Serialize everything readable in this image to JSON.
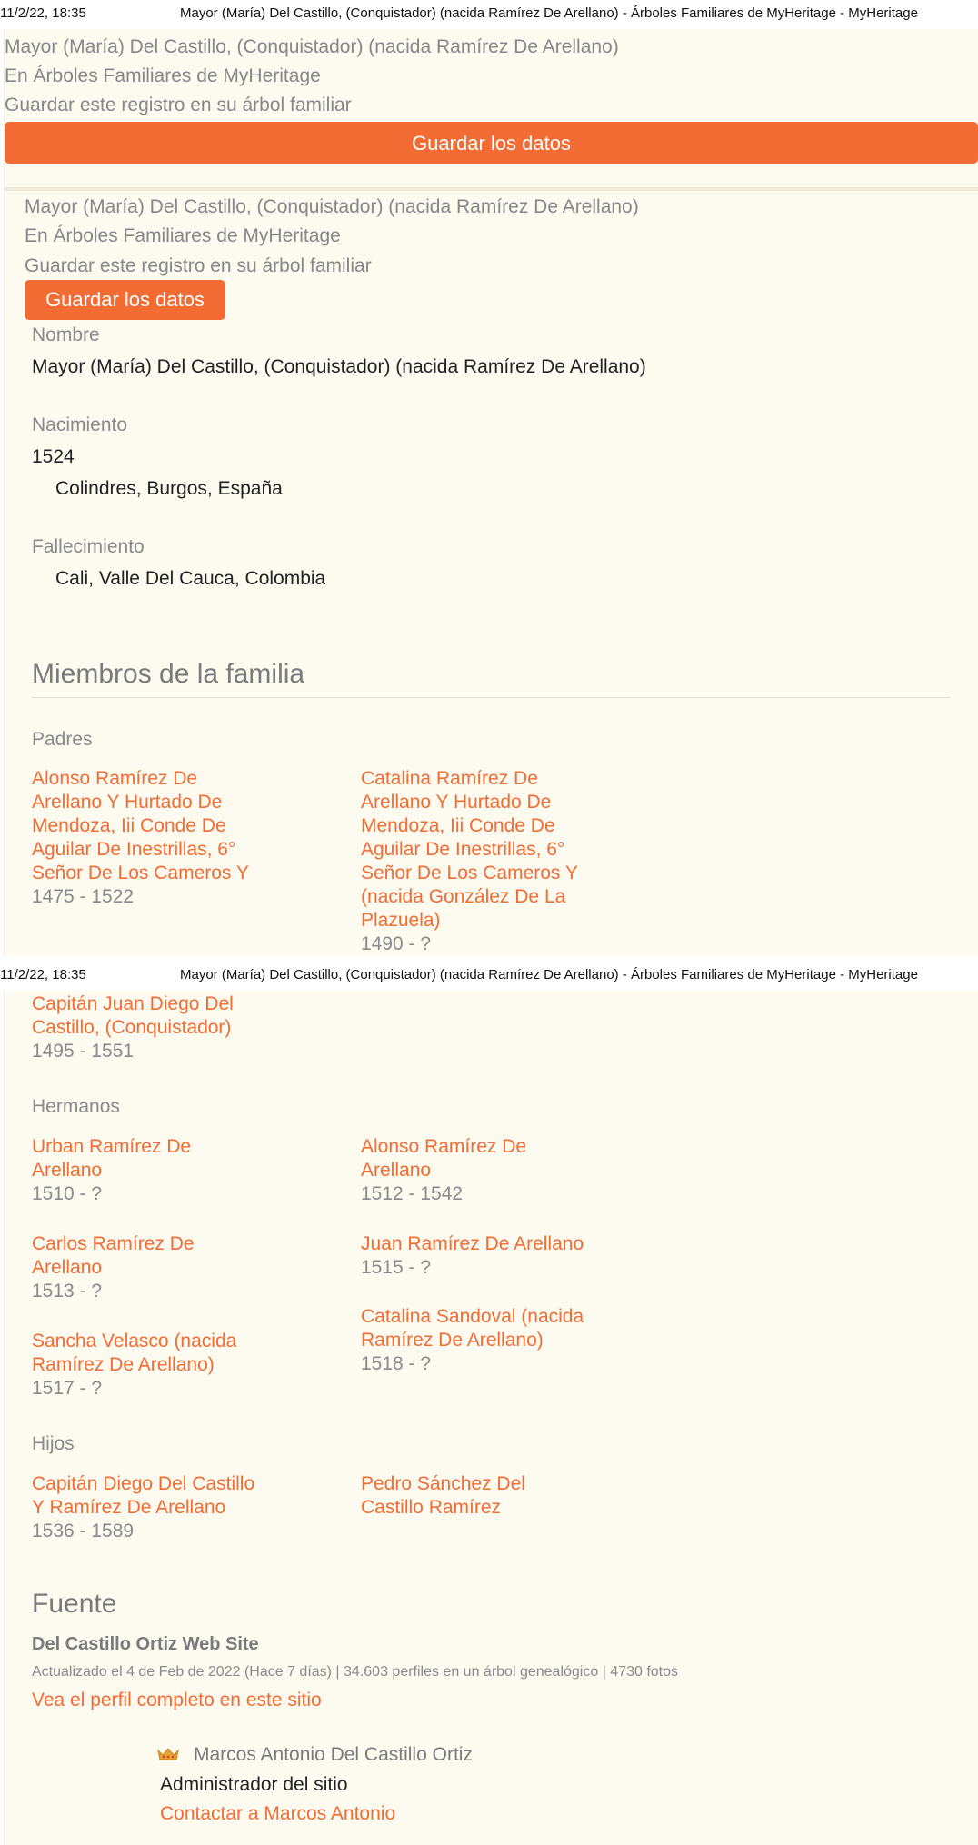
{
  "print": {
    "date": "11/2/22, 18:35",
    "title": "Mayor (María) Del Castillo, (Conquistador) (nacida Ramírez De Arellano) - Árboles Familiares de MyHeritage - MyHeritage"
  },
  "banner_top": {
    "name": "Mayor (María) Del Castillo, (Conquistador) (nacida Ramírez De Arellano)",
    "in_trees": "En Árboles Familiares de MyHeritage",
    "save_hint": "Guardar este registro en su árbol familiar",
    "save_button": "Guardar los datos"
  },
  "banner_second": {
    "name": "Mayor (María) Del Castillo, (Conquistador) (nacida Ramírez De Arellano)",
    "in_trees": "En Árboles Familiares de MyHeritage",
    "save_hint": "Guardar este registro en su árbol familiar",
    "save_button": "Guardar los datos"
  },
  "record": {
    "name_label": "Nombre",
    "name_value": "Mayor (María) Del Castillo, (Conquistador) (nacida Ramírez De Arellano)",
    "birth_label": "Nacimiento",
    "birth_year": "1524",
    "birth_place": "Colindres, Burgos, España",
    "death_label": "Fallecimiento",
    "death_place": "Cali, Valle Del Cauca, Colombia"
  },
  "family": {
    "heading": "Miembros de la familia",
    "parents_label": "Padres",
    "parents": [
      {
        "lines": [
          "Alonso Ramírez De",
          "Arellano Y Hurtado De",
          "Mendoza, Iii Conde De",
          "Aguilar De Inestrillas, 6°",
          "Señor De Los Cameros Y"
        ],
        "years": "1475 - 1522"
      },
      {
        "lines": [
          "Catalina Ramírez De",
          "Arellano Y Hurtado De",
          "Mendoza, Iii Conde De",
          "Aguilar De Inestrillas, 6°",
          "Señor De Los Cameros Y",
          "(nacida González De La",
          "Plazuela)"
        ],
        "years": "1490 - ?"
      }
    ],
    "spouse": {
      "lines": [
        "Capitán Juan Diego Del",
        "Castillo, (Conquistador)"
      ],
      "years": "1495 - 1551"
    },
    "siblings_label": "Hermanos",
    "siblings": [
      {
        "lines": [
          "Urban Ramírez De",
          "Arellano"
        ],
        "years": "1510 - ?"
      },
      {
        "lines": [
          "Alonso Ramírez De",
          "Arellano"
        ],
        "years": "1512 - 1542"
      },
      {
        "lines": [
          "Carlos Ramírez De",
          "Arellano"
        ],
        "years": "1513 - ?"
      },
      {
        "lines": [
          "Juan Ramírez De Arellano"
        ],
        "years": "1515 - ?"
      },
      {
        "lines": [
          "Sancha Velasco (nacida",
          "Ramírez De Arellano)"
        ],
        "years": "1517 - ?"
      },
      {
        "lines": [
          "Catalina Sandoval (nacida",
          "Ramírez De Arellano)"
        ],
        "years": "1518 - ?"
      }
    ],
    "children_label": "Hijos",
    "children": [
      {
        "lines": [
          "Capitán Diego Del Castillo",
          "Y Ramírez De Arellano"
        ],
        "years": "1536 - 1589"
      },
      {
        "lines": [
          "Pedro Sánchez Del",
          "Castillo Ramírez"
        ],
        "years": ""
      }
    ]
  },
  "source": {
    "heading": "Fuente",
    "site_name": "Del Castillo Ortiz Web Site",
    "meta": "Actualizado el 4 de Feb de 2022 (Hace 7 días)  |  34.603 perfiles en un árbol genealógico  |  4730 fotos",
    "full_profile_link": "Vea el perfil completo en este sitio",
    "admin_name": "Marcos Antonio Del Castillo Ortiz",
    "admin_role": "Administrador del sitio",
    "contact_link": "Contactar a Marcos Antonio"
  },
  "icons": {
    "admin": "crown-icon"
  },
  "colors": {
    "accent": "#f36c33",
    "background": "#fdfaf0",
    "muted": "#878787"
  }
}
